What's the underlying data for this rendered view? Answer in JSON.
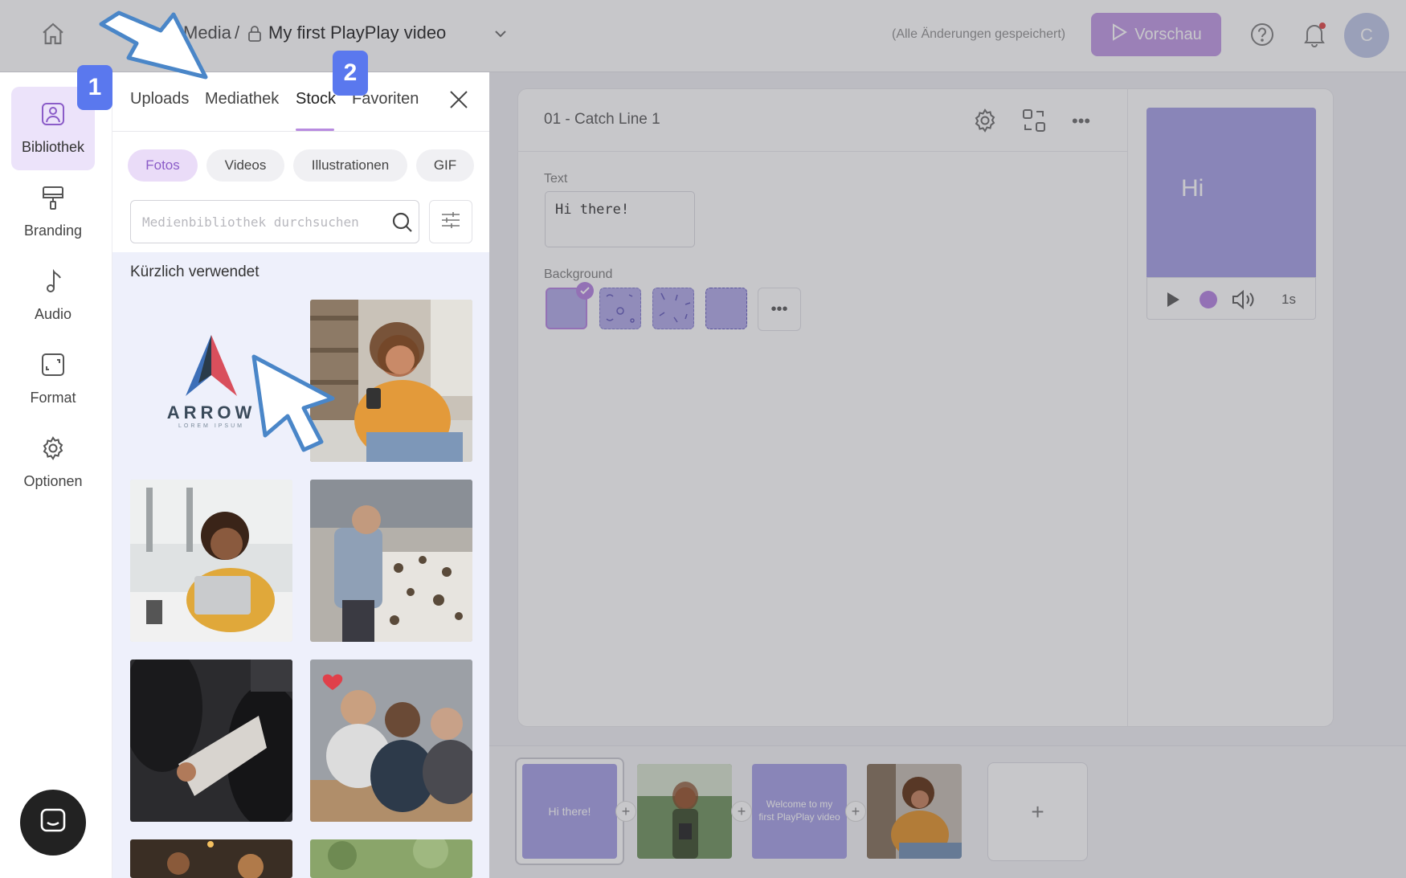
{
  "header": {
    "breadcrumb_parent": "Media",
    "breadcrumb_separator": "/",
    "project_title": "My first PlayPlay video",
    "save_status": "(Alle Änderungen gespeichert)",
    "preview_label": "Vorschau",
    "avatar_initial": "C",
    "accent_color": "#c49fe6"
  },
  "sidebar": {
    "items": [
      {
        "label": "Bibliothek",
        "icon": "image-icon",
        "active": true
      },
      {
        "label": "Branding",
        "icon": "paint-roller-icon"
      },
      {
        "label": "Audio",
        "icon": "music-note-icon"
      },
      {
        "label": "Format",
        "icon": "resize-icon"
      },
      {
        "label": "Optionen",
        "icon": "gear-icon"
      }
    ]
  },
  "panel": {
    "tabs": [
      {
        "label": "Uploads"
      },
      {
        "label": "Mediathek"
      },
      {
        "label": "Stock",
        "active": true
      },
      {
        "label": "Favoriten"
      }
    ],
    "chips": [
      {
        "label": "Fotos",
        "active": true
      },
      {
        "label": "Videos"
      },
      {
        "label": "Illustrationen"
      },
      {
        "label": "GIF"
      }
    ],
    "search_placeholder": "Medienbibliothek durchsuchen",
    "section_title": "Kürzlich verwendet",
    "logo_word": "ARROW",
    "logo_subtext": "LOREM IPSUM"
  },
  "editor": {
    "scene_title": "01 - Catch Line 1",
    "text_label": "Text",
    "text_value": "Hi there!",
    "background_label": "Background",
    "preview_text": "Hi",
    "duration": "1s"
  },
  "timeline": {
    "slides": [
      {
        "text": "Hi there!"
      },
      {
        "text": ""
      },
      {
        "text": "Welcome to my first PlayPlay video"
      },
      {
        "text": ""
      }
    ]
  },
  "annotations": {
    "step1": "1",
    "step2": "2"
  }
}
